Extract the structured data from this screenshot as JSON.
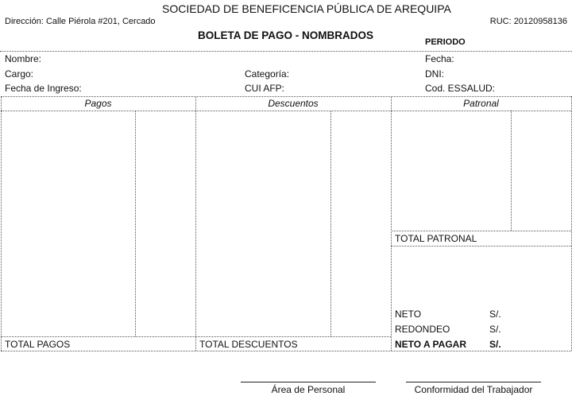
{
  "header": {
    "org_name": "SOCIEDAD DE BENEFICENCIA PÚBLICA DE AREQUIPA",
    "address": "Dirección: Calle Piérola #201, Cercado",
    "ruc": "RUC: 20120958136",
    "doc_title": "BOLETA DE PAGO - NOMBRADOS",
    "periodo_label": "PERIODO"
  },
  "employee": {
    "nombre_label": "Nombre:",
    "cargo_label": "Cargo:",
    "fecha_ingreso_label": "Fecha de Ingreso:",
    "categoria_label": "Categoría:",
    "cui_afp_label": "CUI AFP:",
    "fecha_label": "Fecha:",
    "dni_label": "DNI:",
    "cod_essalud_label": "Cod. ESSALUD:"
  },
  "table": {
    "col_pagos": "Pagos",
    "col_descuentos": "Descuentos",
    "col_patronal": "Patronal",
    "total_pagos": "TOTAL PAGOS",
    "total_descuentos": "TOTAL DESCUENTOS",
    "total_patronal": "TOTAL PATRONAL"
  },
  "summary": {
    "neto_label": "NETO",
    "neto_currency": "S/.",
    "redondeo_label": "REDONDEO",
    "redondeo_currency": "S/.",
    "neto_pagar_label": "NETO A PAGAR",
    "neto_pagar_currency": "S/."
  },
  "signatures": {
    "personal": "Área de Personal",
    "trabajador": "Conformidad del Trabajador"
  }
}
